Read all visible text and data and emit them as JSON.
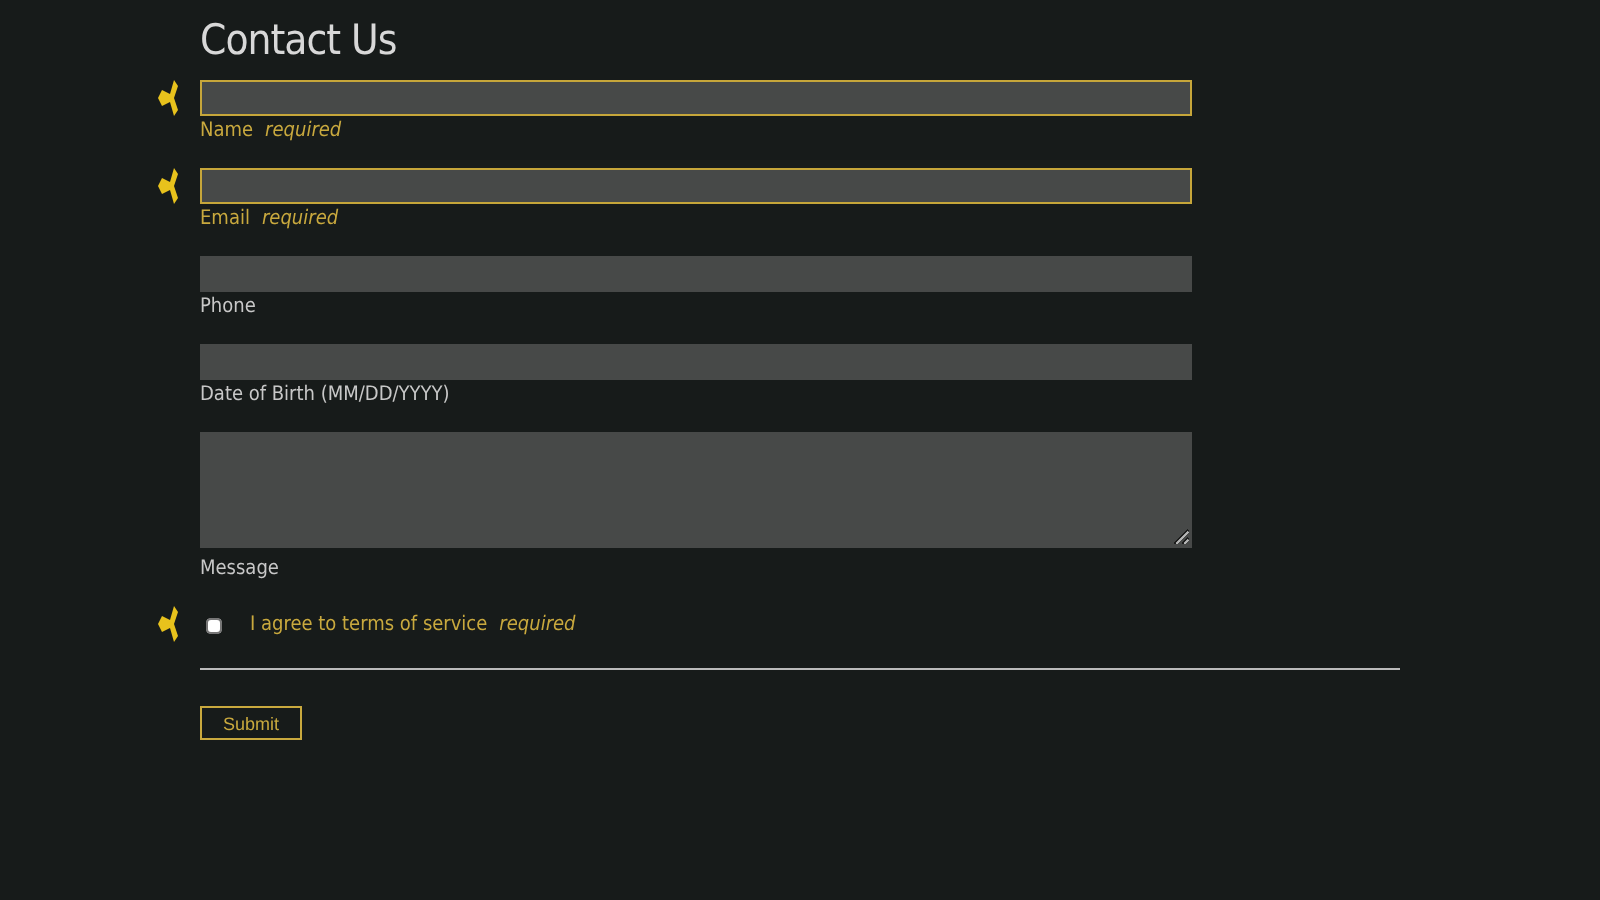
{
  "title": "Contact Us",
  "fields": [
    {
      "kind": "input",
      "label": "Name",
      "required": true,
      "required_text": "required"
    },
    {
      "kind": "input",
      "label": "Email",
      "required": true,
      "required_text": "required"
    },
    {
      "kind": "input",
      "label": "Phone",
      "required": false
    },
    {
      "kind": "input",
      "label": "Date of Birth (MM/DD/YYYY)",
      "required": false
    },
    {
      "kind": "textarea",
      "label": "Message",
      "required": false
    }
  ],
  "agree": {
    "label": "I agree to terms of service",
    "checked": false,
    "required": true,
    "required_text": "required"
  },
  "submit": "Submit"
}
